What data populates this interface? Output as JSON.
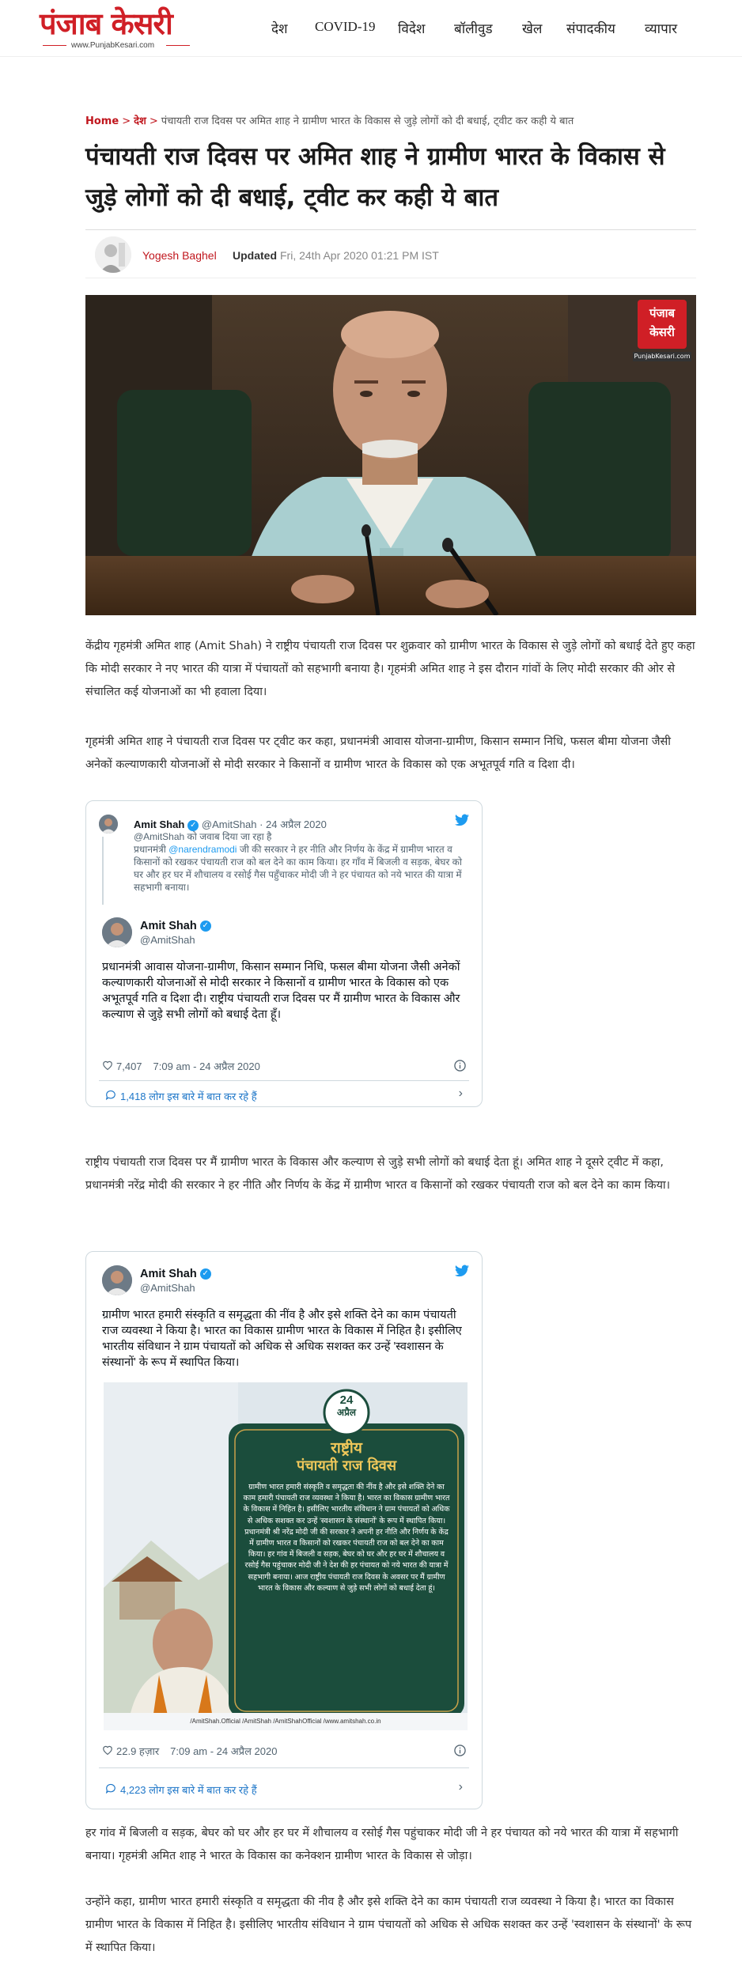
{
  "site": {
    "logo_text": "पंजाब केसरी",
    "logo_url_text": "www.PunjabKesari.com"
  },
  "nav": {
    "items": [
      "देश",
      "COVID-19",
      "विदेश",
      "बॉलीवुड",
      "खेल",
      "संपादकीय",
      "व्यापार"
    ]
  },
  "breadcrumb": {
    "home": "Home",
    "section": "देश",
    "current": "पंचायती राज दिवस पर अमित शाह ने ग्रामीण भारत के विकास से जुड़े लोगों को दी बधाई, ट्वीट कर कही ये बात"
  },
  "article": {
    "title": "पंचायती राज दिवस पर अमित शाह ने ग्रामीण भारत के विकास से जुड़े लोगों को दी बधाई, ट्वीट कर कही ये बात",
    "author": "Yogesh Baghel",
    "updated_label": "Updated",
    "updated_date": "Fri, 24th Apr 2020 01:21 PM IST",
    "hero_badge_line1": "पंजाब",
    "hero_badge_line2": "केसरी",
    "hero_badge_url": "PunjabKesari.com",
    "paragraphs": [
      "केंद्रीय गृहमंत्री अमित शाह (Amit Shah) ने राष्ट्रीय पंचायती राज दिवस पर शुक्रवार को ग्रामीण भारत के विकास से जुड़े लोगों को बधाई देते हुए कहा कि मोदी सरकार ने नए भारत की यात्रा में पंचायतों को सहभागी बनाया है। गृहमंत्री अमित शाह ने इस दौरान गांवों के लिए मोदी सरकार की ओर से संचालित कई योजनाओं का भी हवाला दिया।",
      "गृहमंत्री अमित शाह ने पंचायती राज दिवस पर ट्वीट कर कहा, प्रधानमंत्री आवास योजना-ग्रामीण, किसान सम्मान निधि, फसल बीमा योजना जैसी अनेकों कल्याणकारी योजनाओं से मोदी सरकार ने किसानों व ग्रामीण भारत के विकास को एक अभूतपूर्व गति व दिशा दी।",
      "राष्ट्रीय पंचायती राज दिवस पर मैं ग्रामीण भारत के विकास और कल्याण से जुड़े सभी लोगों को बधाई देता हूं। अमित शाह ने दूसरे ट्वीट में कहा, प्रधानमंत्री नरेंद्र मोदी की सरकार ने हर नीति और निर्णय के केंद्र में ग्रामीण भारत व किसानों को रखकर पंचायती राज को बल देने का काम किया।",
      "हर गांव में बिजली व सड़क, बेघर को घर और हर घर में शौचालय व रसोई गैस पहुंचाकर मोदी जी ने हर पंचायत को नये भारत की यात्रा में सहभागी बनाया। गृहमंत्री अमित शाह ने भारत के विकास का कनेक्शन ग्रामीण भारत के विकास से जोड़ा।",
      "उन्होंने कहा, ग्रामीण भारत हमारी संस्कृति व समृद्धता की नीव है और इसे शक्ति देने का काम पंचायती राज व्यवस्था ने किया है। भारत का विकास ग्रामीण भारत के विकास में निहित है। इसीलिए भारतीय संविधान ने ग्राम पंचायतों को अधिक से अधिक सशक्त कर उन्हें 'स्वशासन के संस्थानों' के रूप में स्थापित किया।"
    ]
  },
  "tweet1": {
    "reply": {
      "name": "Amit Shah",
      "handle": "@AmitShah",
      "date": "· 24 अप्रैल 2020",
      "replying_to": "@AmitShah को जवाब दिया जा रहा है",
      "mention": "@narendramodi",
      "text_before": "प्रधानमंत्री",
      "text_after": "जी की सरकार ने हर नीति और निर्णय के केंद्र में ग्रामीण भारत व किसानों को रखकर पंचायती राज को बल देने का काम किया। हर गाँव में बिजली व सड़क, बेघर को घर और हर घर में शौचालय व रसोई गैस पहुँचाकर मोदी जी ने हर पंचायत को नये भारत की यात्रा में सहभागी बनाया।"
    },
    "main": {
      "name": "Amit Shah",
      "handle": "@AmitShah",
      "text": "प्रधानमंत्री आवास योजना-ग्रामीण, किसान सम्मान निधि, फसल बीमा योजना जैसी अनेकों कल्याणकारी योजनाओं से मोदी सरकार ने किसानों व ग्रामीण भारत के विकास को एक अभूतपूर्व गति व दिशा दी। राष्ट्रीय पंचायती राज दिवस पर मैं ग्रामीण भारत के विकास और कल्याण से जुड़े सभी लोगों को बधाई देता हूँ।",
      "likes": "7,407",
      "time": "7:09 am - 24 अप्रैल 2020",
      "cta": "1,418 लोग इस बारे में बात कर रहे हैं"
    }
  },
  "tweet2": {
    "name": "Amit Shah",
    "handle": "@AmitShah",
    "text": "ग्रामीण भारत हमारी संस्कृति व समृद्धता की नींव है और इसे शक्ति देने का काम पंचायती राज व्यवस्था ने किया है। भारत का विकास ग्रामीण भारत के विकास में निहित है। इसीलिए भारतीय संविधान ने ग्राम पंचायतों को अधिक से अधिक सशक्त कर उन्हें 'स्वशासन के संस्थानों' के रूप में स्थापित किया।",
    "likes": "22.9 हज़ार",
    "time": "7:09 am - 24 अप्रैल 2020",
    "cta": "4,223 लोग इस बारे में बात कर रहे हैं",
    "poster": {
      "date_day": "24",
      "date_month": "अप्रैल",
      "title_line1": "राष्ट्रीय",
      "title_line2": "पंचायती राज दिवस",
      "text": "ग्रामीण भारत हमारी संस्कृति व समृद्धता की नींव है और इसे शक्ति देने का काम हमारी पंचायती राज व्यवस्था ने किया है। भारत का विकास ग्रामीण भारत के विकास में निहित है। इसीलिए भारतीय संविधान ने ग्राम पंचायतों को अधिक से अधिक सशक्त कर उन्हें 'स्वशासन के संस्थानों' के रूप में स्थापित किया। प्रधानमंत्री श्री नरेंद्र मोदी जी की सरकार ने अपनी हर नीति और निर्णय के केंद्र में ग्रामीण भारत व किसानों को रखकर पंचायती राज को बल देने का काम किया। हर गांव में बिजली व सड़क, बेघर को घर और हर घर में शौचालय व रसोई गैस पहुंचाकर मोदी जी ने देश की हर पंचायत को नये भारत की यात्रा में सहभागी बनाया। आज राष्ट्रीय पंचायती राज दिवस के अवसर पर मैं ग्रामीण भारत के विकास और कल्याण से जुड़े सभी लोगों को बधाई देता हूं।",
      "footer": "/AmitShah.Official   /AmitShah   /AmitShahOfficial   /www.amitshah.co.in"
    }
  },
  "colors": {
    "brand_red": "#d01f26",
    "link_blue": "#1d9bf0",
    "poster_green": "#1b4d3c"
  }
}
